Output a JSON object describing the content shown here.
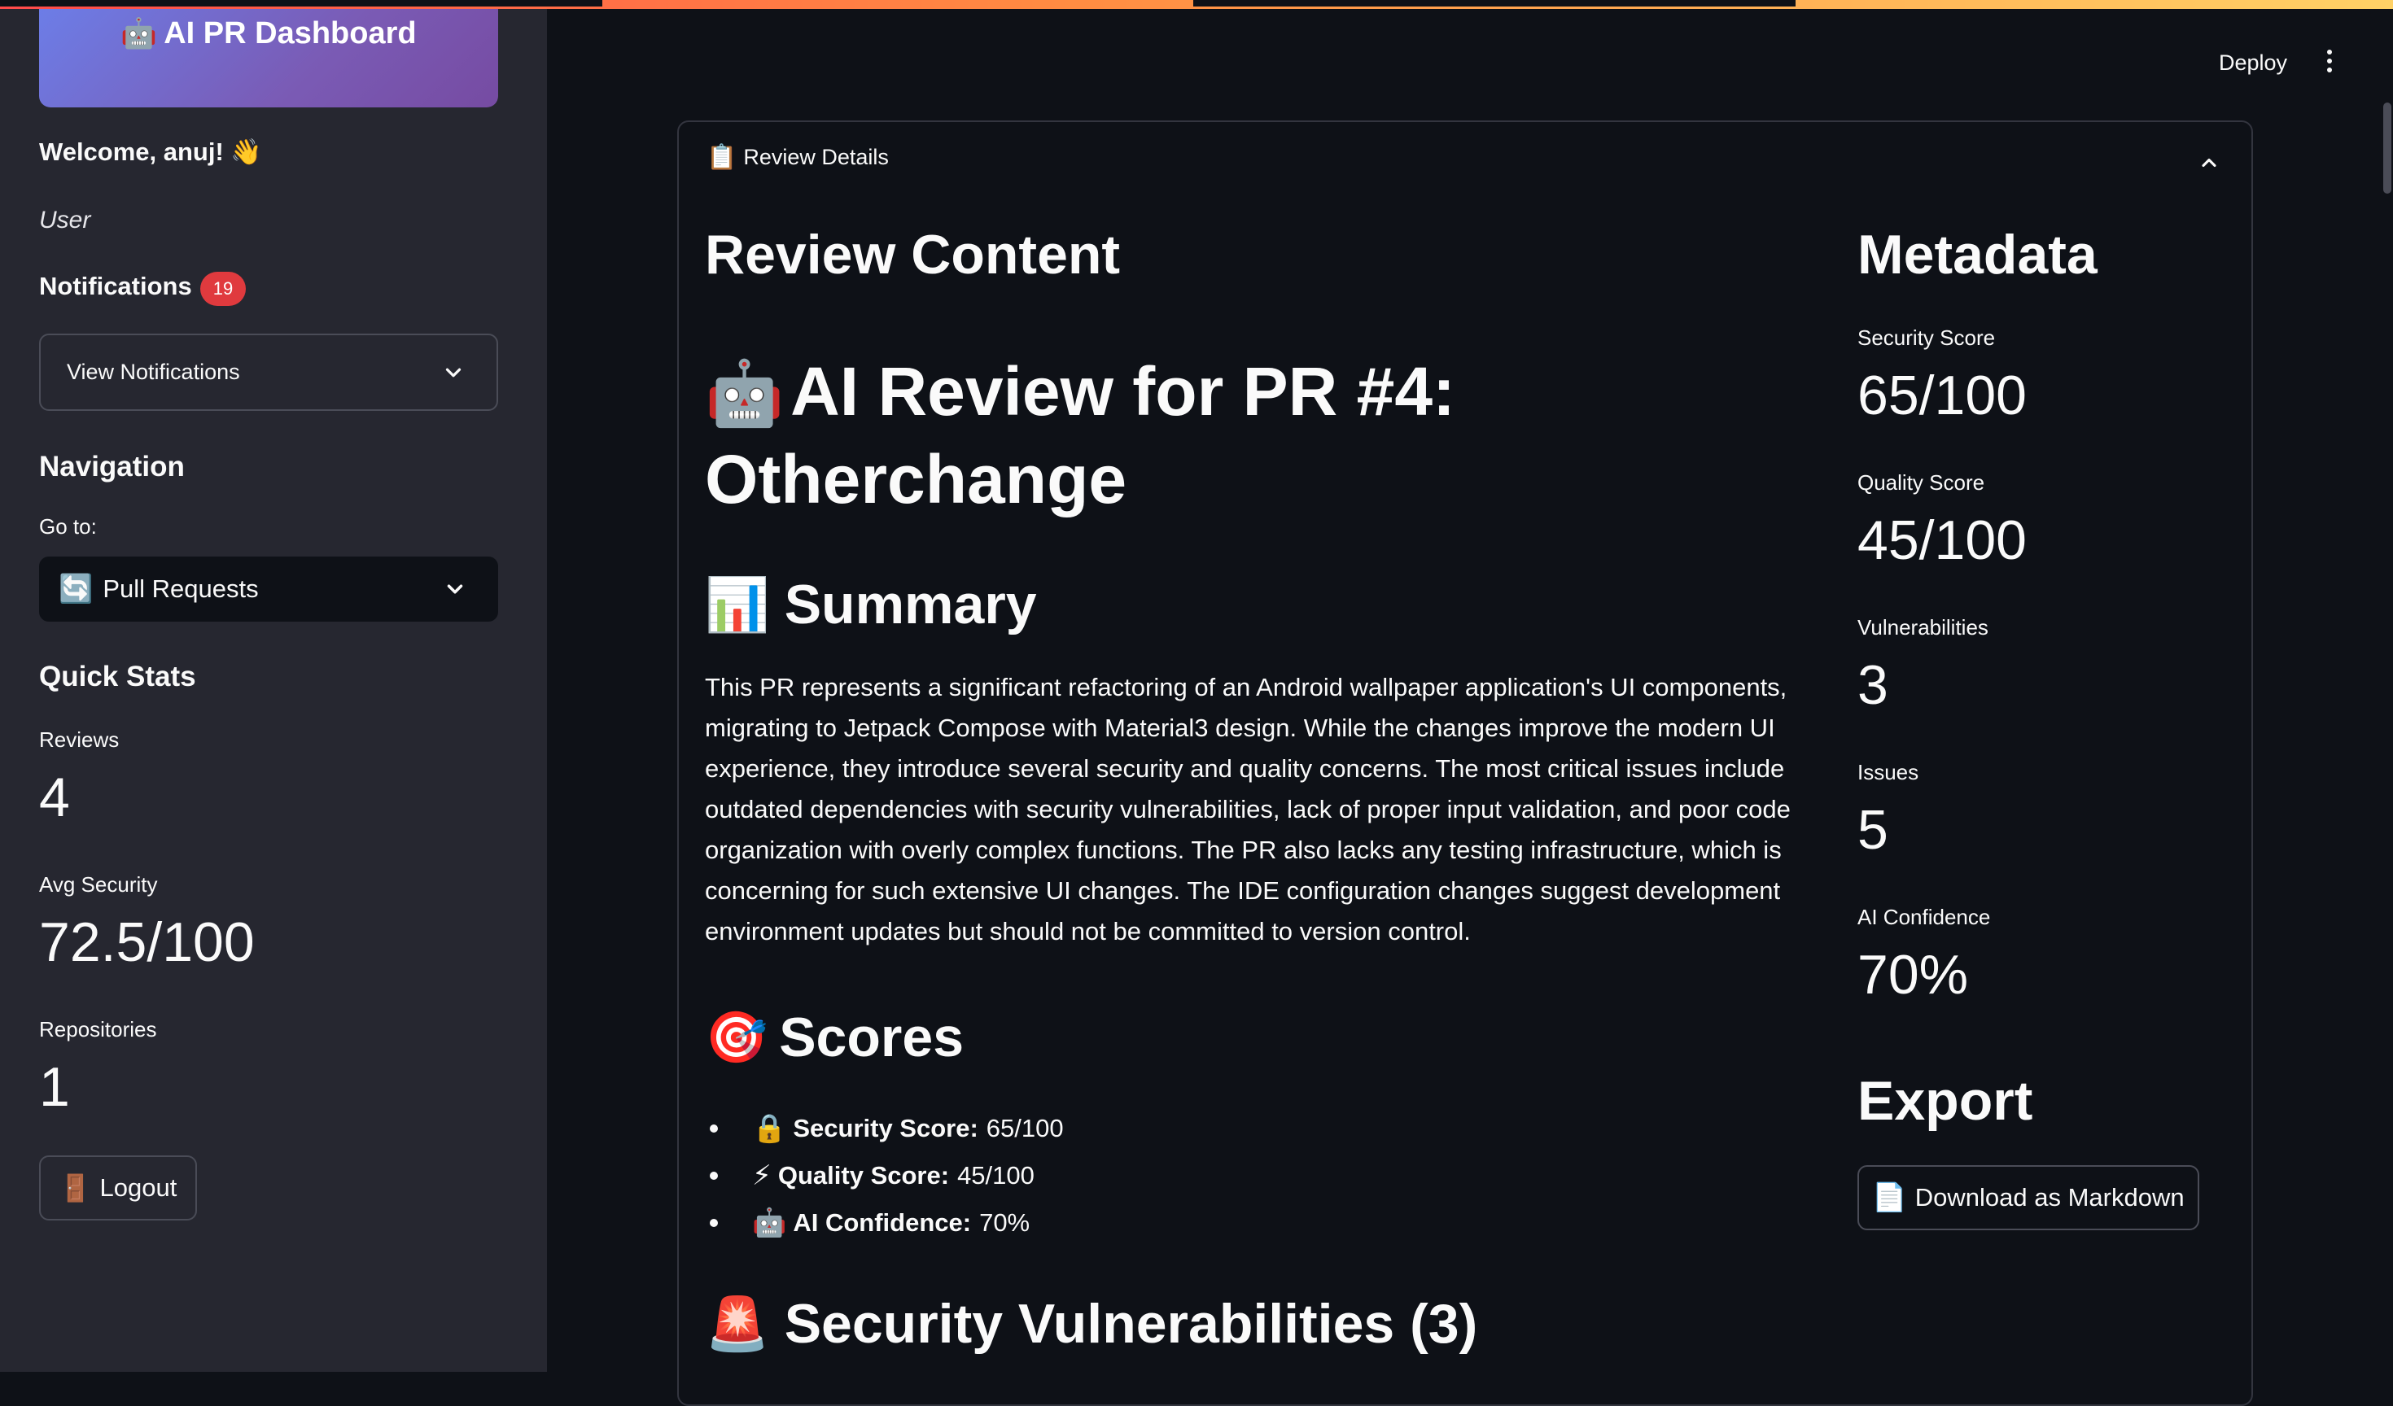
{
  "sidebar": {
    "brand": {
      "icon": "🤖",
      "title": "AI PR Dashboard"
    },
    "welcome": "Welcome, anuj! 👋",
    "role": "User",
    "notifications": {
      "title": "Notifications",
      "count": "19",
      "select_value": "View Notifications"
    },
    "navigation": {
      "title": "Navigation",
      "goto_label": "Go to:",
      "icon": "🔄",
      "selected": "Pull Requests"
    },
    "quick_stats": {
      "title": "Quick Stats",
      "reviews_label": "Reviews",
      "reviews_value": "4",
      "security_label": "Avg Security",
      "security_value": "72.5/100",
      "repos_label": "Repositories",
      "repos_value": "1"
    },
    "logout": {
      "icon": "🚪",
      "label": "Logout"
    }
  },
  "header": {
    "deploy": "Deploy"
  },
  "expander": {
    "icon": "📋",
    "title": "Review Details"
  },
  "content": {
    "heading": "Review Content",
    "pr_icon": "🤖",
    "pr_title": "AI Review for PR #4: Otherchange",
    "summary_icon": "📊",
    "summary_heading": "Summary",
    "summary_text": "This PR represents a significant refactoring of an Android wallpaper application's UI components, migrating to Jetpack Compose with Material3 design. While the changes improve the modern UI experience, they introduce several security and quality concerns. The most critical issues include outdated dependencies with security vulnerabilities, lack of proper input validation, and poor code organization with overly complex functions. The PR also lacks any testing infrastructure, which is concerning for such extensive UI changes. The IDE configuration changes suggest development environment updates but should not be committed to version control.",
    "scores_icon": "🎯",
    "scores_heading": "Scores",
    "scores": [
      {
        "icon": "🔒",
        "label": "Security Score:",
        "value": "65/100"
      },
      {
        "icon": "⚡",
        "label": "Quality Score:",
        "value": "45/100"
      },
      {
        "icon": "🤖",
        "label": "AI Confidence:",
        "value": "70%"
      }
    ],
    "vuln_icon": "🚨",
    "vuln_heading": "Security Vulnerabilities (3)"
  },
  "metadata": {
    "heading": "Metadata",
    "security_label": "Security Score",
    "security_value": "65/100",
    "quality_label": "Quality Score",
    "quality_value": "45/100",
    "vuln_label": "Vulnerabilities",
    "vuln_value": "3",
    "issues_label": "Issues",
    "issues_value": "5",
    "confidence_label": "AI Confidence",
    "confidence_value": "70%",
    "export_heading": "Export",
    "download_icon": "📄",
    "download_label": "Download as Markdown"
  }
}
